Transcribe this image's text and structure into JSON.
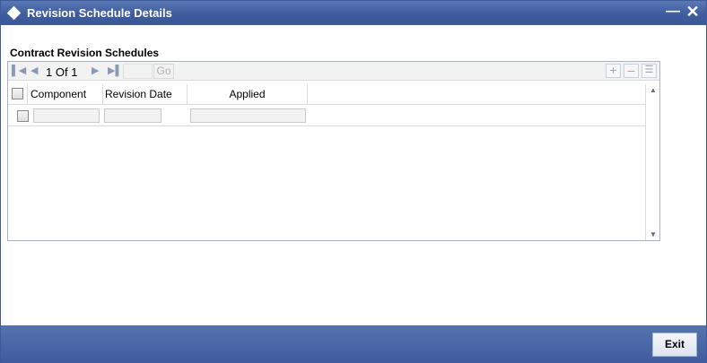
{
  "window": {
    "title": "Revision Schedule Details",
    "minimize_glyph": "‗",
    "close_glyph": "✕"
  },
  "section": {
    "title": "Contract Revision Schedules"
  },
  "pager": {
    "current_page": "1",
    "of_label": "Of",
    "total_pages": "1",
    "page_input_value": "",
    "go_label": "Go"
  },
  "grid": {
    "columns": [
      "Component",
      "Revision Date",
      "Applied"
    ],
    "rows": [
      {
        "component": "",
        "revision_date": "",
        "applied": ""
      }
    ]
  },
  "footer": {
    "exit_label": "Exit"
  },
  "colors": {
    "titlebar": "#3f5d9e",
    "footer": "#3f5d9e",
    "border": "#a9b3c4"
  }
}
